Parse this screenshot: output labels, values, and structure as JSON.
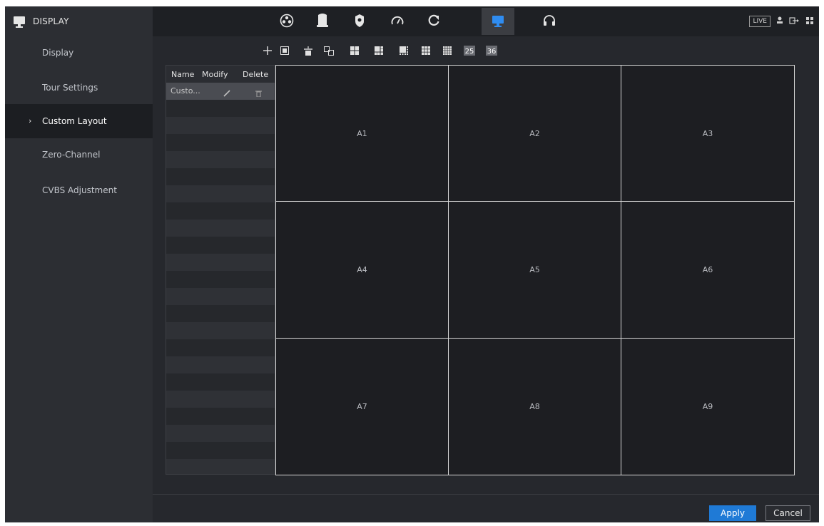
{
  "header": {
    "title": "DISPLAY",
    "live_label": "LIVE",
    "nav_icons": [
      "camera-icon",
      "storage-icon",
      "security-icon",
      "performance-icon",
      "refresh-icon",
      "display-icon",
      "support-icon"
    ],
    "active_nav": "display-icon"
  },
  "sidebar": {
    "items": [
      {
        "label": "Display"
      },
      {
        "label": "Tour Settings"
      },
      {
        "label": "Custom Layout",
        "active": true
      },
      {
        "label": "Zero-Channel"
      },
      {
        "label": "CVBS Adjustment"
      }
    ]
  },
  "toolbar": {
    "buttons": [
      "add-icon",
      "split-add-icon",
      "delete-icon",
      "merge-icon",
      "layout-4-icon",
      "layout-6-icon",
      "layout-8-icon",
      "layout-9-icon",
      "layout-16-icon",
      "layout-25-icon",
      "layout-36-icon"
    ],
    "layout_25_label": "25",
    "layout_36_label": "36"
  },
  "layout_list": {
    "columns": [
      "Name",
      "Modify",
      "Delete"
    ],
    "rows": [
      {
        "name": "Custo..."
      }
    ]
  },
  "grid": {
    "cells": [
      "A1",
      "A2",
      "A3",
      "A4",
      "A5",
      "A6",
      "A7",
      "A8",
      "A9"
    ]
  },
  "buttons": {
    "apply": "Apply",
    "cancel": "Cancel"
  },
  "colors": {
    "accent": "#1f7ad6",
    "active_nav_icon": "#2f8cf0",
    "panel": "#2c2e33",
    "canvas": "#1d1e22"
  }
}
